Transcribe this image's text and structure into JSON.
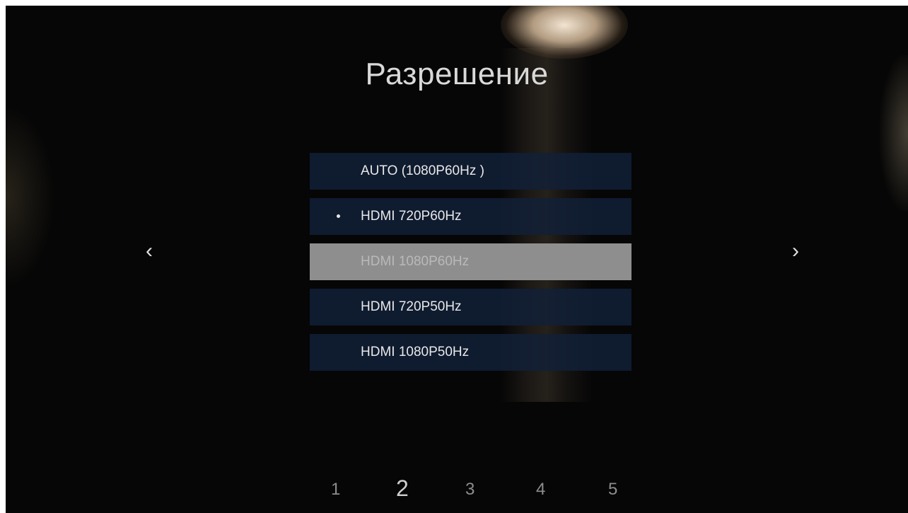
{
  "screen": {
    "title": "Разрешение"
  },
  "resolution_menu": {
    "options": [
      {
        "label": "AUTO (1080P60Hz )"
      },
      {
        "label": "HDMI 720P60Hz"
      },
      {
        "label": "HDMI 1080P60Hz"
      },
      {
        "label": "HDMI 720P50Hz"
      },
      {
        "label": "HDMI 1080P50Hz"
      }
    ],
    "selected_label": "HDMI 720P60Hz",
    "focused_label": "HDMI 1080P60Hz"
  },
  "navigation": {
    "prev_icon": "chevron-left-icon",
    "next_icon": "chevron-right-icon",
    "prev_glyph": "‹",
    "next_glyph": "›"
  },
  "pager": {
    "pages": [
      "1",
      "2",
      "3",
      "4",
      "5"
    ],
    "current": "2"
  },
  "colors": {
    "background": "#060606",
    "option_bg": "#12203a",
    "focused_option_bg": "#8e8e8e",
    "text": "#e8e8e8"
  }
}
